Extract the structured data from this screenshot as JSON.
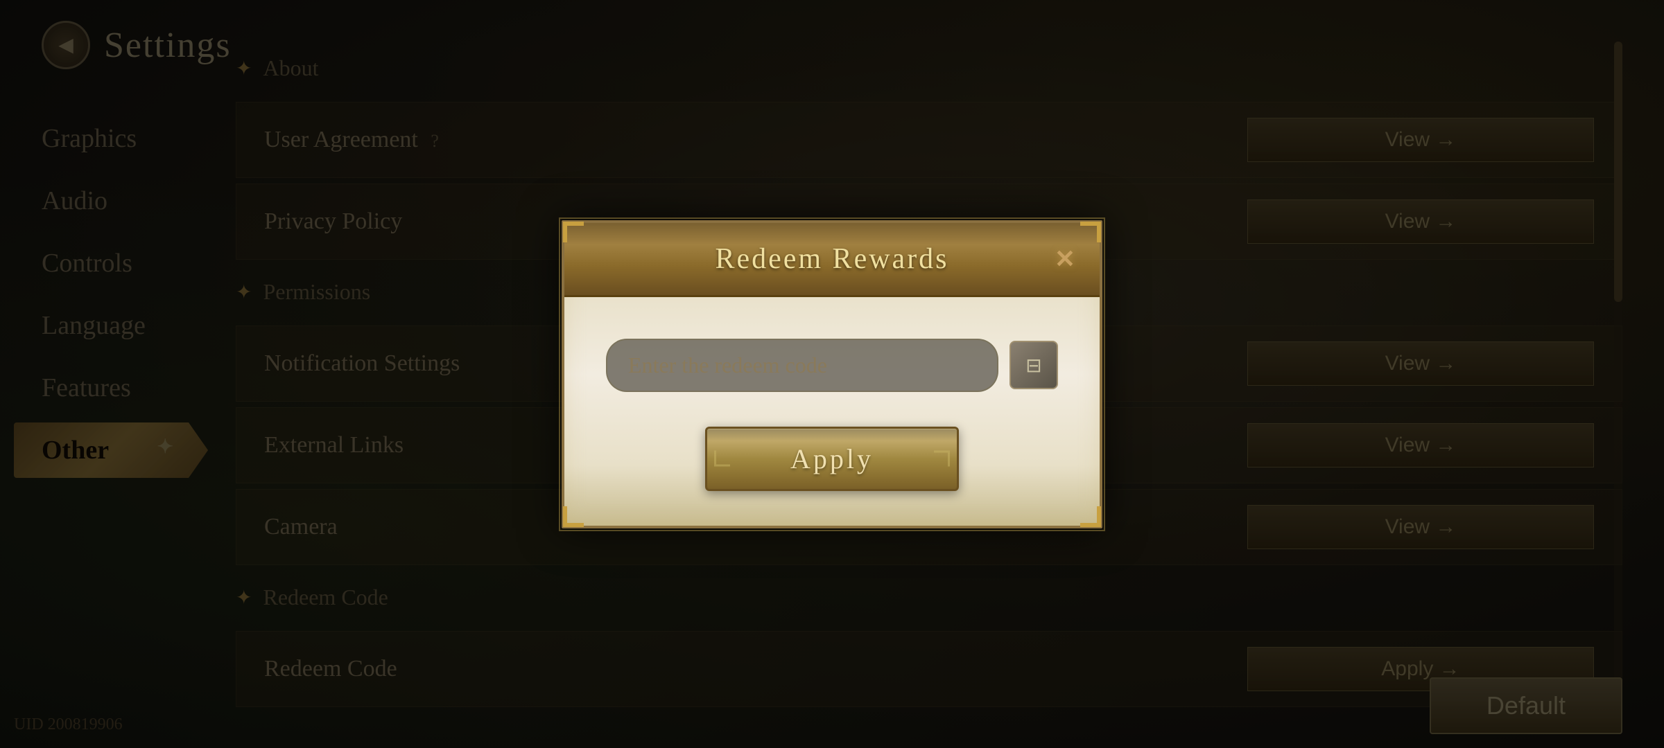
{
  "app": {
    "title": "Settings",
    "uid": "UID 200819906"
  },
  "sidebar": {
    "items": [
      {
        "id": "graphics",
        "label": "Graphics",
        "active": false
      },
      {
        "id": "audio",
        "label": "Audio",
        "active": false
      },
      {
        "id": "controls",
        "label": "Controls",
        "active": false
      },
      {
        "id": "language",
        "label": "Language",
        "active": false
      },
      {
        "id": "features",
        "label": "Features",
        "active": false
      },
      {
        "id": "other",
        "label": "Other",
        "active": true
      }
    ]
  },
  "main": {
    "section_about": "About",
    "rows": [
      {
        "label": "User Agreement",
        "has_question": true,
        "action": "View →"
      },
      {
        "label": "Privacy Policy",
        "has_question": false,
        "action": "View →"
      },
      {
        "label": "Notification Settings",
        "has_question": false,
        "action": "View →"
      },
      {
        "label": "External Links",
        "has_question": false,
        "action": "View →"
      },
      {
        "label": "Camera",
        "has_question": false,
        "action": "View →"
      },
      {
        "label": "Redeem Code",
        "has_question": false,
        "action": "Apply →"
      }
    ],
    "section_permissions": "Permissions",
    "section_redeem": "Redeem Code",
    "default_button": "Default"
  },
  "modal": {
    "title": "Redeem Rewards",
    "close_label": "✕",
    "input_placeholder": "Enter the redeem code",
    "apply_label": "Apply",
    "paste_icon": "⊟"
  }
}
